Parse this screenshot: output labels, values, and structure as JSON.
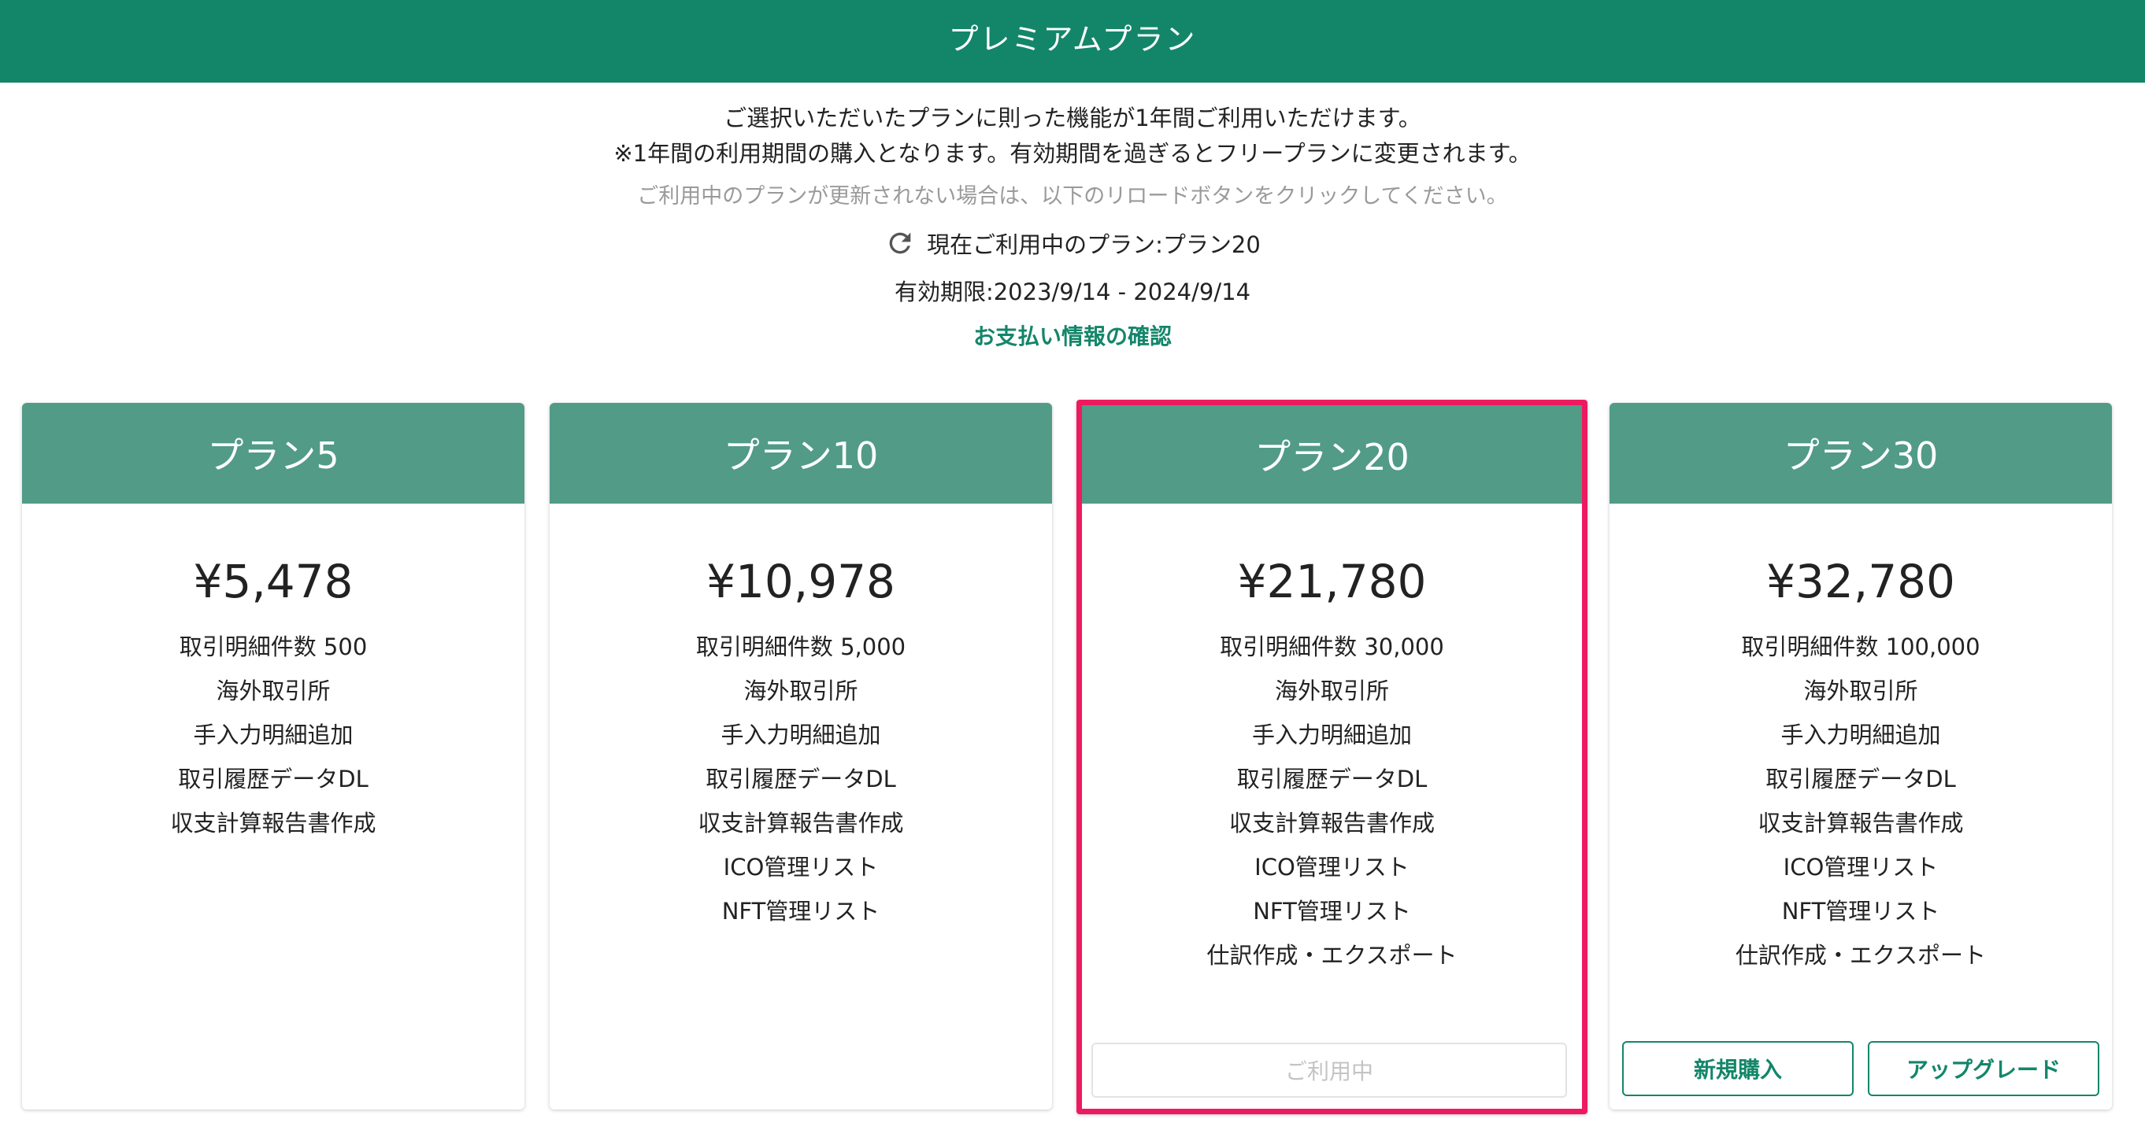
{
  "header": {
    "title": "プレミアムプラン"
  },
  "info": {
    "line1": "ご選択いただいたプランに則った機能が1年間ご利用いただけます。",
    "line2": "※1年間の利用期間の購入となります。有効期間を過ぎるとフリープランに変更されます。",
    "reload_hint": "ご利用中のプランが更新されない場合は、以下のリロードボタンをクリックしてください。",
    "current_plan": "現在ご利用中のプラン:プラン20",
    "reload_icon": "reload-icon",
    "expiry": "有効期限:2023/9/14 - 2024/9/14",
    "billing_link": "お支払い情報の確認"
  },
  "colors": {
    "brand": "#13866a",
    "card_header": "#519b87",
    "current_border": "#ee1a5f"
  },
  "plans": [
    {
      "name": "プラン5",
      "price": "¥5,478",
      "features": [
        "取引明細件数 500",
        "海外取引所",
        "手入力明細追加",
        "取引履歴データDL",
        "収支計算報告書作成"
      ]
    },
    {
      "name": "プラン10",
      "price": "¥10,978",
      "features": [
        "取引明細件数 5,000",
        "海外取引所",
        "手入力明細追加",
        "取引履歴データDL",
        "収支計算報告書作成",
        "ICO管理リスト",
        "NFT管理リスト"
      ]
    },
    {
      "name": "プラン20",
      "price": "¥21,780",
      "features": [
        "取引明細件数 30,000",
        "海外取引所",
        "手入力明細追加",
        "取引履歴データDL",
        "収支計算報告書作成",
        "ICO管理リスト",
        "NFT管理リスト",
        "仕訳作成・エクスポート"
      ],
      "status_button": "ご利用中"
    },
    {
      "name": "プラン30",
      "price": "¥32,780",
      "features": [
        "取引明細件数 100,000",
        "海外取引所",
        "手入力明細追加",
        "取引履歴データDL",
        "収支計算報告書作成",
        "ICO管理リスト",
        "NFT管理リスト",
        "仕訳作成・エクスポート"
      ],
      "buttons": {
        "new": "新規購入",
        "upgrade": "アップグレード"
      }
    }
  ]
}
